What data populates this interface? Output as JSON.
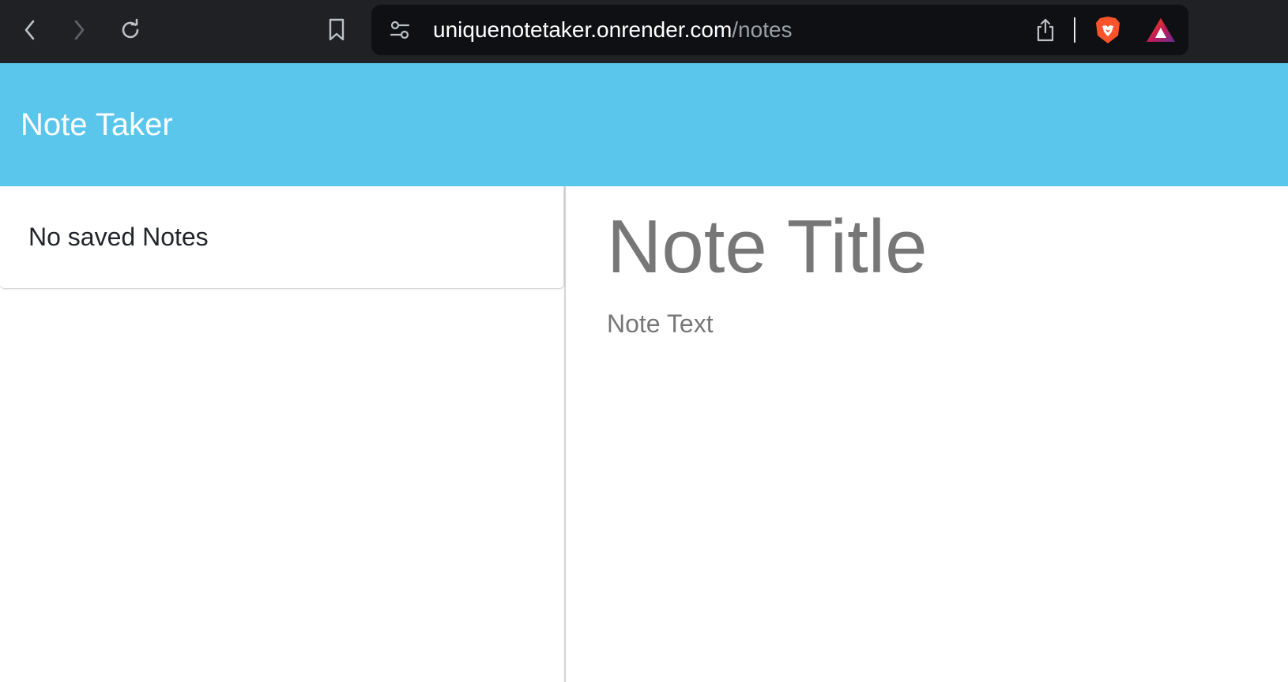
{
  "browser": {
    "url_host": "uniquenotetaker.onrender.com",
    "url_path": "/notes",
    "icons": {
      "back": "chevron-left-icon",
      "forward": "chevron-right-icon",
      "reload": "reload-icon",
      "bookmark": "bookmark-icon",
      "site_settings": "sliders-icon",
      "share": "share-icon",
      "brave_shields": "brave-lion-icon",
      "rewards": "brave-rewards-triangle-icon"
    },
    "colors": {
      "toolbar_bg": "#202124",
      "url_bar_bg": "#0f1013",
      "brave_orange": "#fb542b",
      "rewards_purple": "#662d91"
    }
  },
  "app": {
    "title": "Note Taker",
    "header_color": "#5bc6ec"
  },
  "notes_list": {
    "empty_message": "No saved Notes"
  },
  "editor": {
    "title_placeholder": "Note Title",
    "text_placeholder": "Note Text"
  }
}
